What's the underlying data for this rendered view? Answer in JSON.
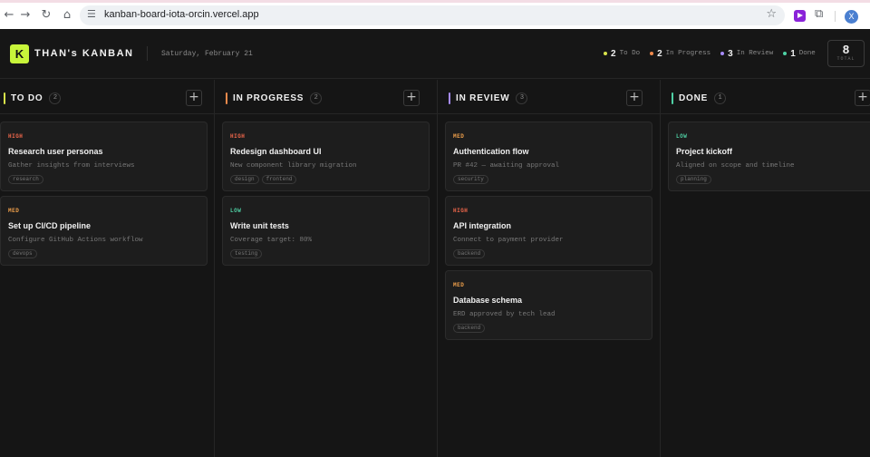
{
  "browser": {
    "url": "kanban-board-iota-orcin.vercel.app",
    "avatar_letter": "X",
    "icons": [
      "back-icon",
      "forward-icon",
      "reload-icon",
      "home-icon",
      "site-settings-icon",
      "bookmark-star-icon",
      "extension-play-icon",
      "extensions-puzzle-icon"
    ]
  },
  "header": {
    "logo_letter": "K",
    "title": "THAN's KANBAN",
    "date": "Saturday, February 21",
    "stats": [
      {
        "count": "2",
        "label": "To Do",
        "color": "#d8e34a"
      },
      {
        "count": "2",
        "label": "In Progress",
        "color": "#f08a4b"
      },
      {
        "count": "3",
        "label": "In Review",
        "color": "#a78bfa"
      },
      {
        "count": "1",
        "label": "Done",
        "color": "#4fd1a5"
      }
    ],
    "total": "8",
    "total_label": "TOTAL"
  },
  "colors": {
    "high": "#f0674b",
    "med": "#f0a04b",
    "low": "#4fd1a5",
    "todo": "#d8e34a",
    "in_progress": "#f08a4b",
    "in_review": "#a78bfa",
    "done": "#4fd1a5"
  },
  "columns": [
    {
      "title": "TO DO",
      "count": "2",
      "add": "+",
      "cards": [
        {
          "priority": "HIGH",
          "title": "Research user personas",
          "desc": "Gather insights from interviews",
          "tags": [
            "research"
          ]
        },
        {
          "priority": "MED",
          "title": "Set up CI/CD pipeline",
          "desc": "Configure GitHub Actions workflow",
          "tags": [
            "devops"
          ]
        }
      ]
    },
    {
      "title": "IN PROGRESS",
      "count": "2",
      "add": "+",
      "cards": [
        {
          "priority": "HIGH",
          "title": "Redesign dashboard UI",
          "desc": "New component library migration",
          "tags": [
            "design",
            "frontend"
          ]
        },
        {
          "priority": "LOW",
          "title": "Write unit tests",
          "desc": "Coverage target: 80%",
          "tags": [
            "testing"
          ]
        }
      ]
    },
    {
      "title": "IN REVIEW",
      "count": "3",
      "add": "+",
      "cards": [
        {
          "priority": "MED",
          "title": "Authentication flow",
          "desc": "PR #42 — awaiting approval",
          "tags": [
            "security"
          ]
        },
        {
          "priority": "HIGH",
          "title": "API integration",
          "desc": "Connect to payment provider",
          "tags": [
            "backend"
          ]
        },
        {
          "priority": "MED",
          "title": "Database schema",
          "desc": "ERD approved by tech lead",
          "tags": [
            "backend"
          ]
        }
      ]
    },
    {
      "title": "DONE",
      "count": "1",
      "add": "+",
      "cards": [
        {
          "priority": "LOW",
          "title": "Project kickoff",
          "desc": "Aligned on scope and timeline",
          "tags": [
            "planning"
          ]
        }
      ]
    }
  ]
}
